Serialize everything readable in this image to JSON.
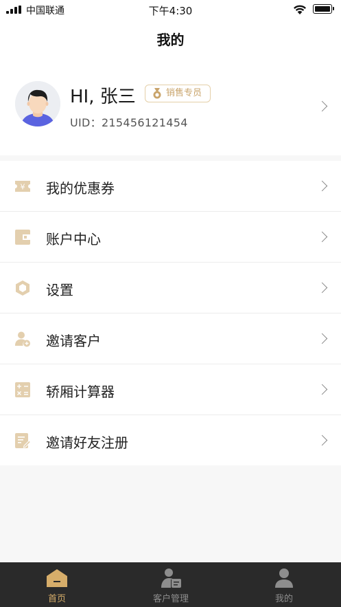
{
  "status_bar": {
    "carrier": "中国联通",
    "time": "下午4:30"
  },
  "nav": {
    "title": "我的"
  },
  "profile": {
    "greeting": "HI, 张三",
    "badge": "销售专员",
    "uid_label": "UID：",
    "uid_value": "215456121454"
  },
  "menu": [
    {
      "label": "我的优惠券",
      "icon": "coupon-icon"
    },
    {
      "label": "账户中心",
      "icon": "wallet-icon"
    },
    {
      "label": "设置",
      "icon": "settings-hexagon-icon"
    },
    {
      "label": "邀请客户",
      "icon": "add-user-icon"
    },
    {
      "label": "轿厢计算器",
      "icon": "calculator-icon"
    },
    {
      "label": "邀请好友注册",
      "icon": "edit-document-icon"
    }
  ],
  "tabbar": [
    {
      "label": "首页",
      "icon": "home-icon",
      "active": true
    },
    {
      "label": "客户管理",
      "icon": "customer-card-icon",
      "active": false
    },
    {
      "label": "我的",
      "icon": "person-icon",
      "active": false
    }
  ],
  "colors": {
    "accent": "#d6ad6a",
    "icon_tan": "#e3cfae",
    "tabbar_bg": "#2a2a2a"
  }
}
